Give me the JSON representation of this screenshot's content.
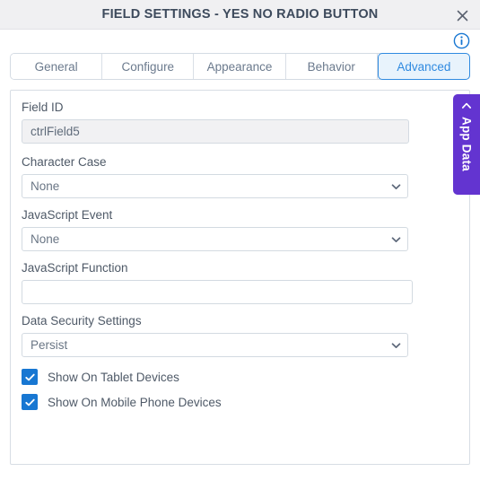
{
  "titlebar": {
    "title": "FIELD SETTINGS - YES NO RADIO BUTTON",
    "close_icon": "close-icon"
  },
  "header": {
    "info_icon": "info-icon"
  },
  "tabs": [
    {
      "label": "General",
      "active": false
    },
    {
      "label": "Configure",
      "active": false
    },
    {
      "label": "Appearance",
      "active": false
    },
    {
      "label": "Behavior",
      "active": false
    },
    {
      "label": "Advanced",
      "active": true
    }
  ],
  "form": {
    "field_id": {
      "label": "Field ID",
      "value": "ctrlField5",
      "placeholder": ""
    },
    "character_case": {
      "label": "Character Case",
      "value": "None",
      "options": [
        "None"
      ]
    },
    "javascript_event": {
      "label": "JavaScript Event",
      "value": "None",
      "options": [
        "None"
      ]
    },
    "javascript_function": {
      "label": "JavaScript Function",
      "value": "",
      "placeholder": ""
    },
    "data_security_settings": {
      "label": "Data Security Settings",
      "value": "Persist",
      "options": [
        "Persist"
      ]
    },
    "show_tablet": {
      "label": "Show On Tablet Devices",
      "checked": true
    },
    "show_mobile": {
      "label": "Show On Mobile Phone Devices",
      "checked": true
    }
  },
  "app_data_tab": {
    "label": "App Data",
    "chevron_icon": "chevron-left-icon"
  },
  "colors": {
    "accent_blue": "#2f8ae0",
    "checkbox_blue": "#1877d2",
    "app_data_purple": "#6334d0",
    "titlebar_bg": "#f0f0f2",
    "label_text": "#4e5967"
  }
}
